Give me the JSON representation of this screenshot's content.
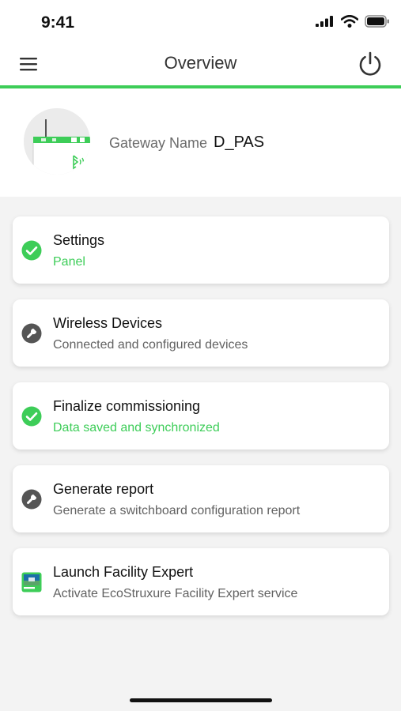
{
  "status_bar": {
    "time": "9:41"
  },
  "header": {
    "title": "Overview"
  },
  "gateway": {
    "label": "Gateway Name",
    "value": "D_PAS"
  },
  "cards": [
    {
      "title": "Settings",
      "subtitle": "Panel",
      "status": "complete",
      "icon": "check-circle-icon"
    },
    {
      "title": "Wireless Devices",
      "subtitle": "Connected and configured devices",
      "status": "pending",
      "icon": "wrench-icon"
    },
    {
      "title": "Finalize commissioning",
      "subtitle": "Data saved and synchronized",
      "status": "complete",
      "icon": "check-circle-icon"
    },
    {
      "title": "Generate report",
      "subtitle": "Generate a switchboard configuration report",
      "status": "pending",
      "icon": "wrench-icon"
    },
    {
      "title": "Launch Facility Expert",
      "subtitle": "Activate EcoStruxure Facility Expert service",
      "status": "app",
      "icon": "facility-expert-app-icon"
    }
  ],
  "colors": {
    "accent": "#3dcd58",
    "pending_icon": "#555555"
  }
}
